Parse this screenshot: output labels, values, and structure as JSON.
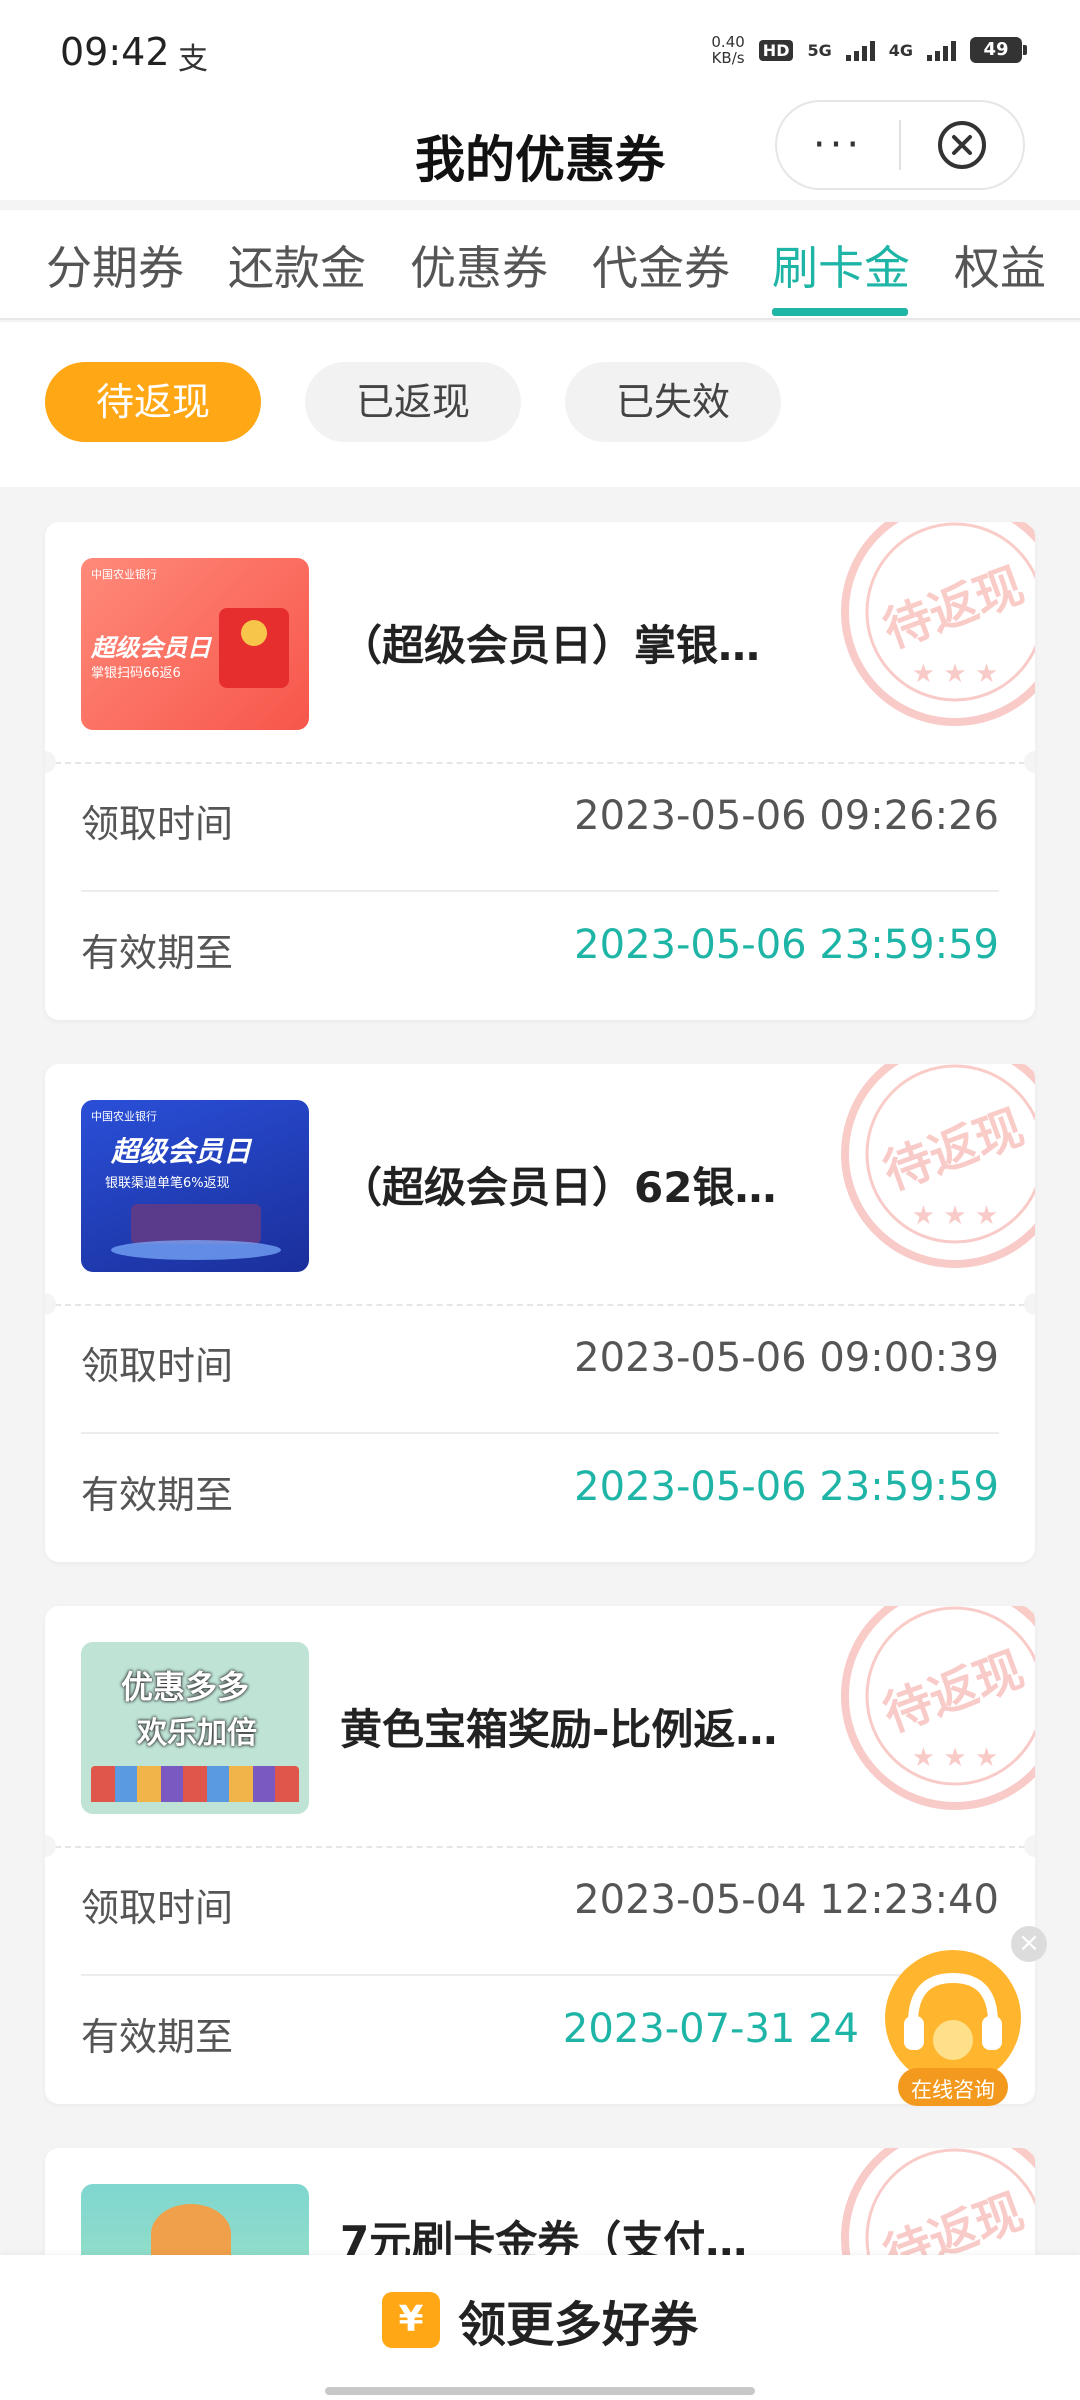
{
  "status_bar": {
    "time": "09:42",
    "app_glyph": "支",
    "speed_value": "0.40",
    "speed_unit": "KB/s",
    "hd": "HD",
    "network_5g": "5G",
    "network_4g": "4G",
    "battery": "49"
  },
  "header": {
    "title": "我的优惠券",
    "more_label": "···"
  },
  "tabs": [
    {
      "label": "分期券",
      "active": false
    },
    {
      "label": "还款金",
      "active": false
    },
    {
      "label": "优惠券",
      "active": false
    },
    {
      "label": "代金券",
      "active": false
    },
    {
      "label": "刷卡金",
      "active": true
    },
    {
      "label": "权益",
      "active": false
    }
  ],
  "filters": [
    {
      "label": "待返现",
      "active": true
    },
    {
      "label": "已返现",
      "active": false
    },
    {
      "label": "已失效",
      "active": false
    }
  ],
  "cards": [
    {
      "title": "（超级会员日）掌银…",
      "stamp": "待返现",
      "thumb": {
        "bank": "中国农业银行",
        "headline": "超级会员日",
        "sub": "掌银扫码66返6"
      },
      "claim_label": "领取时间",
      "claim_time": "2023-05-06 09:26:26",
      "expire_label": "有效期至",
      "expire_time": "2023-05-06 23:59:59"
    },
    {
      "title": "（超级会员日）62银…",
      "stamp": "待返现",
      "thumb": {
        "bank": "中国农业银行",
        "headline": "超级会员日",
        "sub": "银联渠道单笔6%返现"
      },
      "claim_label": "领取时间",
      "claim_time": "2023-05-06 09:00:39",
      "expire_label": "有效期至",
      "expire_time": "2023-05-06 23:59:59"
    },
    {
      "title": "黄色宝箱奖励-比例返…",
      "stamp": "待返现",
      "thumb": {
        "headline": "优惠多多",
        "sub": "欢乐加倍"
      },
      "claim_label": "领取时间",
      "claim_time": "2023-05-04 12:23:40",
      "expire_label": "有效期至",
      "expire_time": "2023-07-31 24"
    },
    {
      "title": "7元刷卡金券（支付…",
      "stamp": "待返现"
    }
  ],
  "float_button": {
    "label": "在线咨询",
    "close": "×"
  },
  "bottom_bar": {
    "icon": "¥",
    "label": "领更多好券"
  },
  "colors": {
    "accent_teal": "#1fb5a6",
    "accent_orange": "#ffa714",
    "stamp_red": "#e8483c"
  }
}
